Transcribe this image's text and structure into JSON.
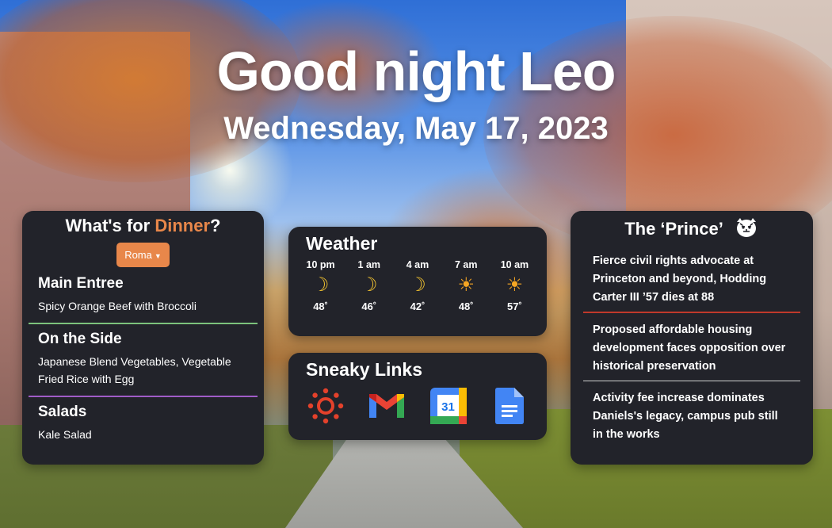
{
  "greeting": "Good night Leo",
  "date": "Wednesday, May 17, 2023",
  "dinner": {
    "title_prefix": "What's for ",
    "title_accent": "Dinner",
    "title_suffix": "?",
    "accent_color": "#e8874a",
    "dining_hall": "Roma",
    "sections": [
      {
        "heading": "Main Entree",
        "items": "Spicy Orange Beef with Broccoli",
        "divider_color": "#7cc27c"
      },
      {
        "heading": "On the Side",
        "items": "Japanese Blend Vegetables, Vegetable Fried Rice with Egg",
        "divider_color": "#a05cc8"
      },
      {
        "heading": "Salads",
        "items": "Kale Salad"
      }
    ]
  },
  "weather": {
    "title": "Weather",
    "hours": [
      {
        "time": "10 pm",
        "icon": "moon-icon",
        "temp": "48˚"
      },
      {
        "time": "1 am",
        "icon": "moon-icon",
        "temp": "46˚"
      },
      {
        "time": "4 am",
        "icon": "moon-icon",
        "temp": "42˚"
      },
      {
        "time": "7 am",
        "icon": "sun-icon",
        "temp": "48˚"
      },
      {
        "time": "10 am",
        "icon": "sun-icon",
        "temp": "57˚"
      }
    ]
  },
  "links": {
    "title": "Sneaky Links",
    "items": [
      {
        "name": "canvas-icon"
      },
      {
        "name": "gmail-icon"
      },
      {
        "name": "google-calendar-icon",
        "label": "31"
      },
      {
        "name": "google-docs-icon"
      }
    ]
  },
  "prince": {
    "title": "The ‘Prince’",
    "headlines": [
      "Fierce civil rights advocate at Princeton and beyond, Hodding Carter III ’57 dies at 88",
      "Proposed affordable housing development faces opposition over historical preservation",
      "Activity fee increase dominates Daniels's legacy, campus pub still in the works"
    ],
    "divider_colors": [
      "#c0392b",
      "#cfcfcf"
    ]
  }
}
